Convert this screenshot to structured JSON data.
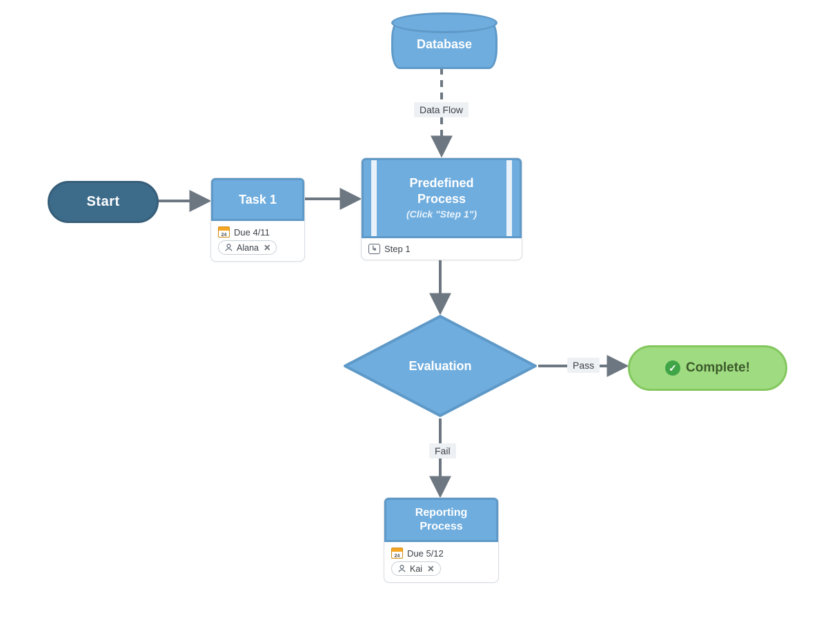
{
  "nodes": {
    "start": {
      "label": "Start"
    },
    "task1": {
      "label": "Task 1",
      "due": "Due 4/11",
      "assignee": "Alana"
    },
    "database": {
      "label": "Database"
    },
    "predefined": {
      "title": "Predefined Process",
      "hint": "(Click \"Step 1\")",
      "subprocess": "Step 1"
    },
    "evaluation": {
      "label": "Evaluation"
    },
    "reporting": {
      "label": "Reporting Process",
      "due": "Due 5/12",
      "assignee": "Kai"
    },
    "complete": {
      "label": "Complete!"
    }
  },
  "edges": {
    "dataflow": {
      "label": "Data Flow"
    },
    "pass": {
      "label": "Pass"
    },
    "fail": {
      "label": "Fail"
    }
  },
  "colors": {
    "primary": "#6fadde",
    "primary_border": "#5e99c8",
    "start_fill": "#3d6b8a",
    "success_fill": "#9fdb80",
    "success_border": "#83c75f",
    "arrow": "#6d7781"
  }
}
